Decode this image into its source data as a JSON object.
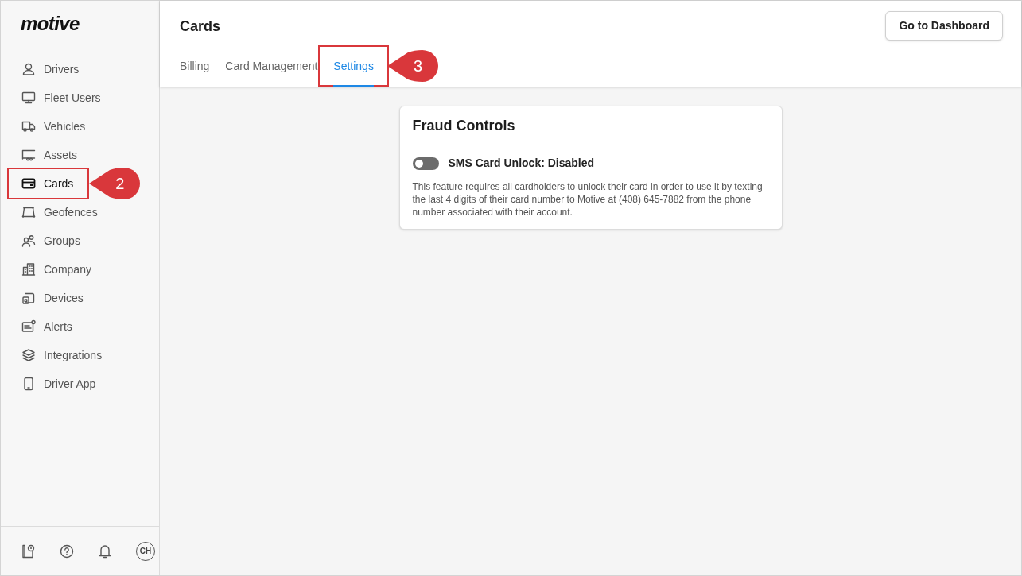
{
  "logo": "motive",
  "sidebar": {
    "items": [
      {
        "label": "Drivers",
        "selected": false
      },
      {
        "label": "Fleet Users",
        "selected": false
      },
      {
        "label": "Vehicles",
        "selected": false
      },
      {
        "label": "Assets",
        "selected": false
      },
      {
        "label": "Cards",
        "selected": true,
        "callout": "2"
      },
      {
        "label": "Geofences",
        "selected": false
      },
      {
        "label": "Groups",
        "selected": false
      },
      {
        "label": "Company",
        "selected": false
      },
      {
        "label": "Devices",
        "selected": false
      },
      {
        "label": "Alerts",
        "selected": false
      },
      {
        "label": "Integrations",
        "selected": false
      },
      {
        "label": "Driver App",
        "selected": false
      }
    ],
    "avatar": "CH"
  },
  "header": {
    "title": "Cards",
    "button": "Go to Dashboard"
  },
  "tabs": [
    {
      "label": "Billing",
      "selected": false
    },
    {
      "label": "Card Management",
      "selected": false
    },
    {
      "label": "Settings",
      "selected": true,
      "callout": "3"
    }
  ],
  "card": {
    "title": "Fraud Controls",
    "toggle": {
      "label": "SMS Card Unlock: Disabled",
      "on": false
    },
    "description": "This feature requires all cardholders to unlock their card in order to use it by texting the last 4 digits of their card number to Motive at (408) 645-7882 from the phone number associated with their account."
  }
}
